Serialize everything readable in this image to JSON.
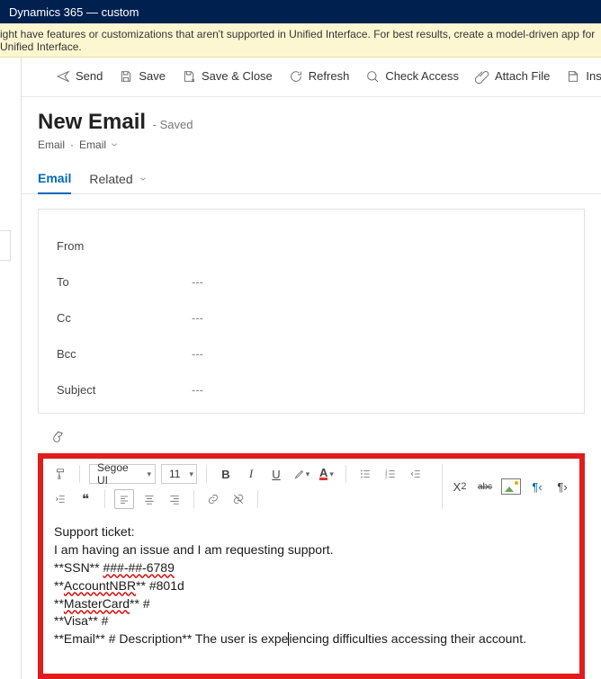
{
  "app": {
    "title": "Dynamics 365 — custom"
  },
  "warning": {
    "text": "ight have features or customizations that aren't supported in Unified Interface. For best results, create a model-driven app for Unified Interface."
  },
  "cmd": {
    "send": "Send",
    "save": "Save",
    "saveClose": "Save & Close",
    "refresh": "Refresh",
    "checkAccess": "Check Access",
    "attach": "Attach File",
    "insertTemplate": "Insert Template"
  },
  "page": {
    "title": "New Email",
    "suffix": "- Saved",
    "crumb1": "Email",
    "crumb2": "Email"
  },
  "tabs": {
    "email": "Email",
    "related": "Related"
  },
  "form": {
    "from": {
      "label": "From",
      "value": ""
    },
    "to": {
      "label": "To",
      "value": "---"
    },
    "cc": {
      "label": "Cc",
      "value": "---"
    },
    "bcc": {
      "label": "Bcc",
      "value": "---"
    },
    "subject": {
      "label": "Subject",
      "value": "---"
    }
  },
  "editor": {
    "font": "Segoe UI",
    "size": "11",
    "abc_sub": "2",
    "rightTools": {
      "abc": "abc"
    },
    "body": {
      "l1": "Support ticket:",
      "l2": "I am having an issue and I am requesting support.",
      "l3a": "**SSN** ",
      "l3b": "###-##-6789",
      "l4a": "**",
      "l4b": "AccountNBR",
      "l4c": "**  #801d",
      "l5a": "**",
      "l5b": "MasterCard",
      "l5c": "** #",
      "l6": "**Visa** #",
      "l7a": "**Email** # Description** The user is expe",
      "l7b": "iencing difficulties accessing their account."
    }
  }
}
